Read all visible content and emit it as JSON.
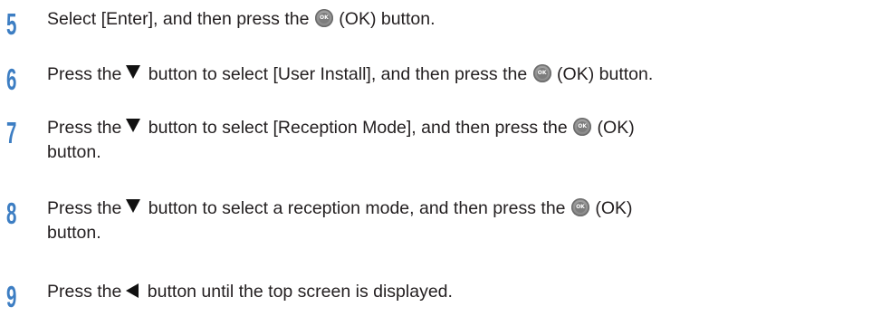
{
  "steps": [
    {
      "number": "5",
      "parts": [
        "Select [Enter], and then press the",
        "(OK) button."
      ]
    },
    {
      "number": "6",
      "parts": [
        "Press the",
        "button to select [User Install], and then press the",
        "(OK) button."
      ]
    },
    {
      "number": "7",
      "parts": [
        "Press the",
        "button to select [Reception Mode], and then press the",
        "(OK)",
        "button."
      ]
    },
    {
      "number": "8",
      "parts": [
        "Press the",
        "button to select a reception mode, and then press the",
        "(OK)",
        "button."
      ]
    },
    {
      "number": "9",
      "parts": [
        "Press the",
        "button until the top screen is displayed."
      ]
    }
  ],
  "icons": {
    "ok_button_label": "OK",
    "ok_icon": "ok-button-icon",
    "down_icon": "down-arrow-button-icon",
    "left_icon": "left-arrow-button-icon"
  },
  "colors": {
    "step_number": "#3d7ec3",
    "text": "#231f20"
  }
}
